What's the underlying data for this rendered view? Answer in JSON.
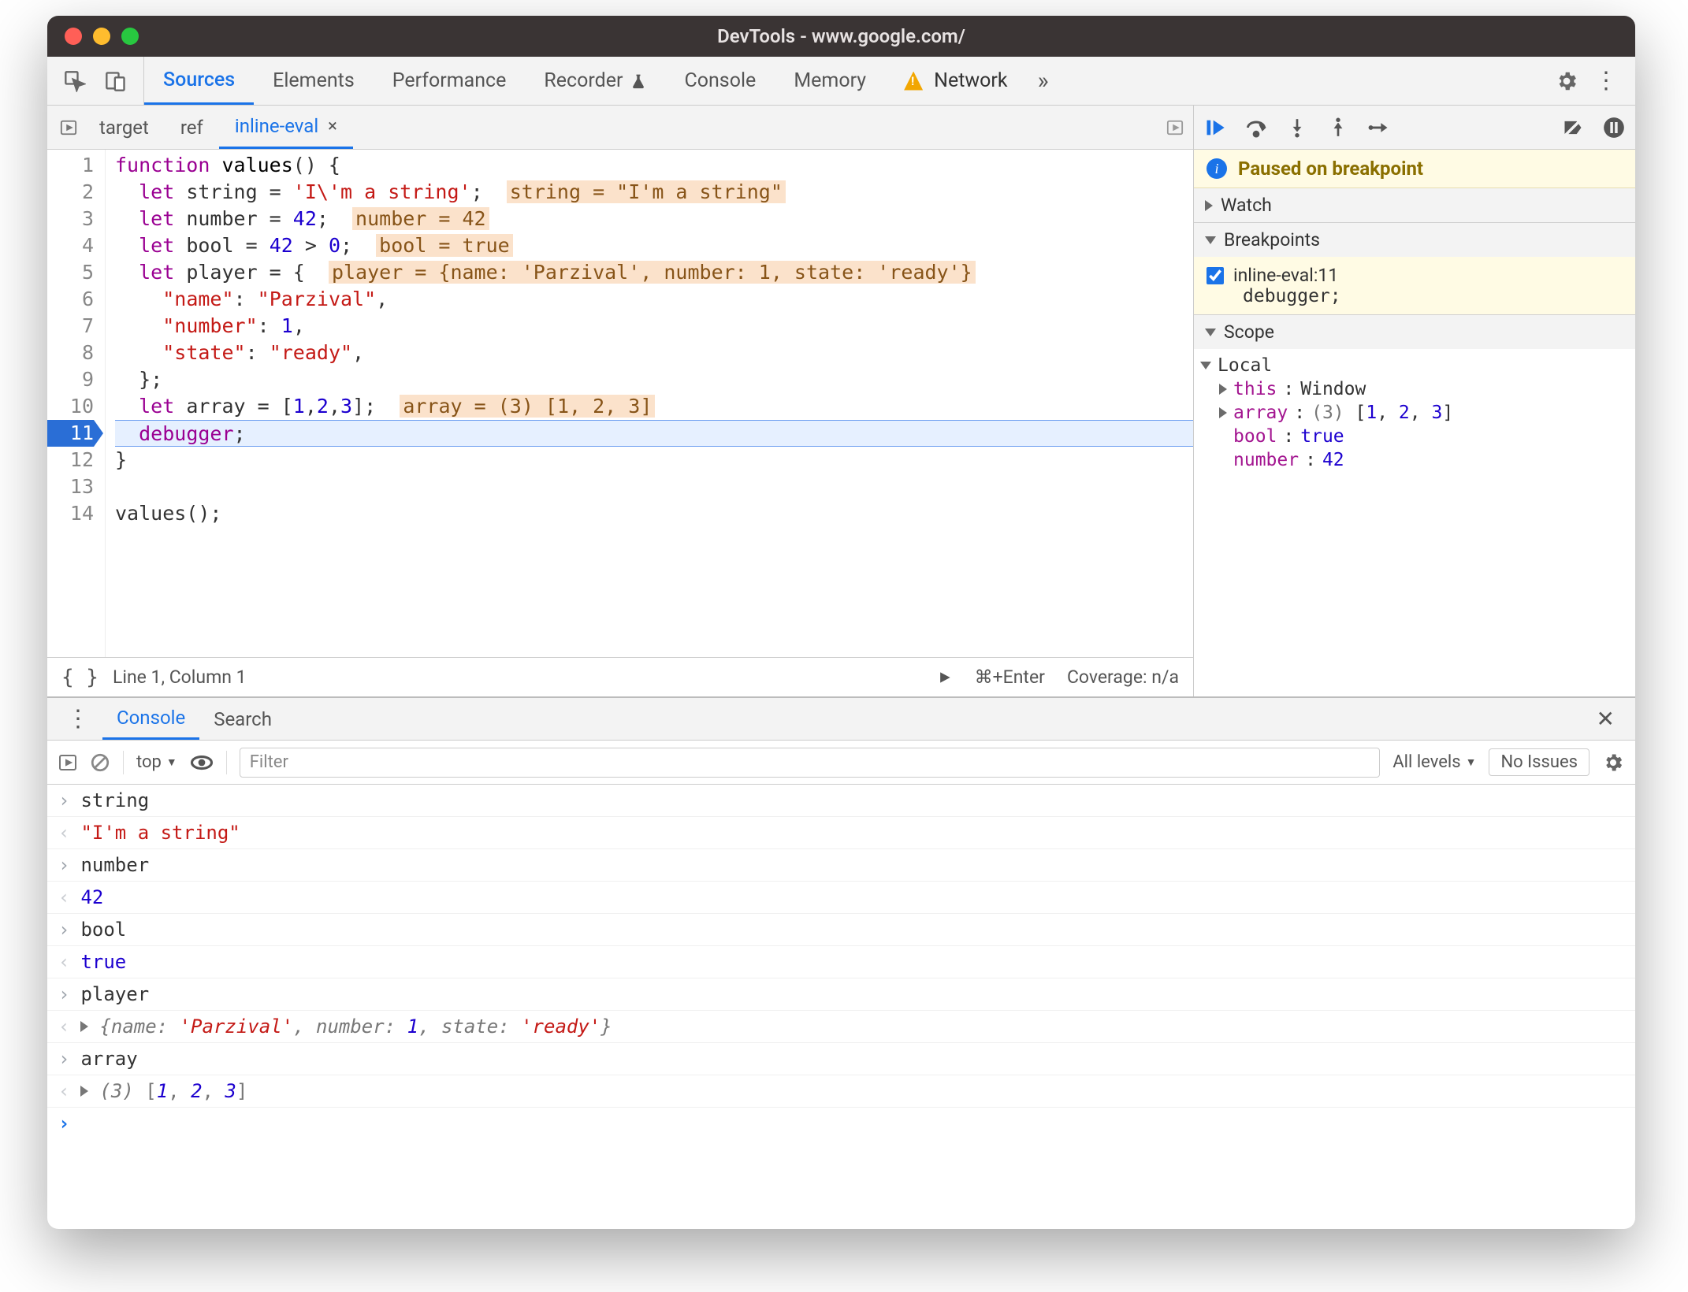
{
  "window": {
    "title": "DevTools - www.google.com/"
  },
  "mainTabs": {
    "items": [
      "Sources",
      "Elements",
      "Performance",
      "Recorder",
      "Console",
      "Memory",
      "Network"
    ],
    "active": 0,
    "recorderBeaker": true,
    "networkWarning": true
  },
  "fileTabs": {
    "items": [
      {
        "label": "target",
        "closable": false
      },
      {
        "label": "ref",
        "closable": false
      },
      {
        "label": "inline-eval",
        "closable": true
      }
    ],
    "active": 2
  },
  "code": {
    "currentLine": 11,
    "lines": [
      {
        "n": 1,
        "seg": [
          {
            "t": "function ",
            "c": "kw"
          },
          {
            "t": "values",
            "c": "fn"
          },
          {
            "t": "() {",
            "c": ""
          }
        ]
      },
      {
        "n": 2,
        "seg": [
          {
            "t": "  ",
            "c": ""
          },
          {
            "t": "let",
            "c": "kw"
          },
          {
            "t": " string = ",
            "c": ""
          },
          {
            "t": "'I\\'m a string'",
            "c": "str"
          },
          {
            "t": ";  ",
            "c": ""
          }
        ],
        "inline": "string = \"I'm a string\""
      },
      {
        "n": 3,
        "seg": [
          {
            "t": "  ",
            "c": ""
          },
          {
            "t": "let",
            "c": "kw"
          },
          {
            "t": " number = ",
            "c": ""
          },
          {
            "t": "42",
            "c": "num"
          },
          {
            "t": ";  ",
            "c": ""
          }
        ],
        "inline": "number = 42"
      },
      {
        "n": 4,
        "seg": [
          {
            "t": "  ",
            "c": ""
          },
          {
            "t": "let",
            "c": "kw"
          },
          {
            "t": " bool = ",
            "c": ""
          },
          {
            "t": "42",
            "c": "num"
          },
          {
            "t": " > ",
            "c": ""
          },
          {
            "t": "0",
            "c": "num"
          },
          {
            "t": ";  ",
            "c": ""
          }
        ],
        "inline": "bool = true"
      },
      {
        "n": 5,
        "seg": [
          {
            "t": "  ",
            "c": ""
          },
          {
            "t": "let",
            "c": "kw"
          },
          {
            "t": " player = {  ",
            "c": ""
          }
        ],
        "inline": "player = {name: 'Parzival', number: 1, state: 'ready'}"
      },
      {
        "n": 6,
        "seg": [
          {
            "t": "    ",
            "c": ""
          },
          {
            "t": "\"name\"",
            "c": "prop"
          },
          {
            "t": ": ",
            "c": ""
          },
          {
            "t": "\"Parzival\"",
            "c": "str"
          },
          {
            "t": ",",
            "c": ""
          }
        ]
      },
      {
        "n": 7,
        "seg": [
          {
            "t": "    ",
            "c": ""
          },
          {
            "t": "\"number\"",
            "c": "prop"
          },
          {
            "t": ": ",
            "c": ""
          },
          {
            "t": "1",
            "c": "num"
          },
          {
            "t": ",",
            "c": ""
          }
        ]
      },
      {
        "n": 8,
        "seg": [
          {
            "t": "    ",
            "c": ""
          },
          {
            "t": "\"state\"",
            "c": "prop"
          },
          {
            "t": ": ",
            "c": ""
          },
          {
            "t": "\"ready\"",
            "c": "str"
          },
          {
            "t": ",",
            "c": ""
          }
        ]
      },
      {
        "n": 9,
        "seg": [
          {
            "t": "  };",
            "c": ""
          }
        ]
      },
      {
        "n": 10,
        "seg": [
          {
            "t": "  ",
            "c": ""
          },
          {
            "t": "let",
            "c": "kw"
          },
          {
            "t": " array = [",
            "c": ""
          },
          {
            "t": "1",
            "c": "num"
          },
          {
            "t": ",",
            "c": ""
          },
          {
            "t": "2",
            "c": "num"
          },
          {
            "t": ",",
            "c": ""
          },
          {
            "t": "3",
            "c": "num"
          },
          {
            "t": "];  ",
            "c": ""
          }
        ],
        "inline": "array = (3) [1, 2, 3]"
      },
      {
        "n": 11,
        "seg": [
          {
            "t": "  ",
            "c": ""
          },
          {
            "t": "debugger",
            "c": "token-debugger"
          },
          {
            "t": ";",
            "c": ""
          }
        ]
      },
      {
        "n": 12,
        "seg": [
          {
            "t": "}",
            "c": ""
          }
        ]
      },
      {
        "n": 13,
        "seg": [
          {
            "t": "",
            "c": ""
          }
        ]
      },
      {
        "n": 14,
        "seg": [
          {
            "t": "values();",
            "c": ""
          }
        ]
      }
    ]
  },
  "statusbar": {
    "position": "Line 1, Column 1",
    "runHint": "⌘+Enter",
    "coverage": "Coverage: n/a"
  },
  "debugger": {
    "paused": "Paused on breakpoint",
    "sections": {
      "watch": "Watch",
      "breakpoints": "Breakpoints",
      "scope": "Scope"
    },
    "breakpoint": {
      "label": "inline-eval:11",
      "text": "debugger;",
      "checked": true
    },
    "scope": {
      "local": "Local",
      "entries": [
        {
          "type": "expand",
          "key": "this",
          "val": "Window"
        },
        {
          "type": "expand",
          "key": "array",
          "val": "(3) [1, 2, 3]",
          "arr": true
        },
        {
          "type": "plain",
          "key": "bool",
          "val": "true",
          "cls": "v-bool"
        },
        {
          "type": "plain",
          "key": "number",
          "val": "42",
          "cls": "v-num"
        }
      ]
    }
  },
  "drawer": {
    "tabs": [
      "Console",
      "Search"
    ],
    "active": 0,
    "context": "top",
    "levels": "All levels",
    "issues": "No Issues",
    "filterPlaceholder": "Filter",
    "rows": [
      {
        "dir": "in",
        "text": "string"
      },
      {
        "dir": "out",
        "kind": "str",
        "text": "\"I'm a string\""
      },
      {
        "dir": "in",
        "text": "number"
      },
      {
        "dir": "out",
        "kind": "num",
        "text": "42"
      },
      {
        "dir": "in",
        "text": "bool"
      },
      {
        "dir": "out",
        "kind": "bool",
        "text": "true"
      },
      {
        "dir": "in",
        "text": "player"
      },
      {
        "dir": "out",
        "kind": "obj",
        "text": "{name: 'Parzival', number: 1, state: 'ready'}",
        "expand": true
      },
      {
        "dir": "in",
        "text": "array"
      },
      {
        "dir": "out",
        "kind": "arr",
        "text": "(3) [1, 2, 3]",
        "expand": true
      },
      {
        "dir": "prompt"
      }
    ]
  }
}
